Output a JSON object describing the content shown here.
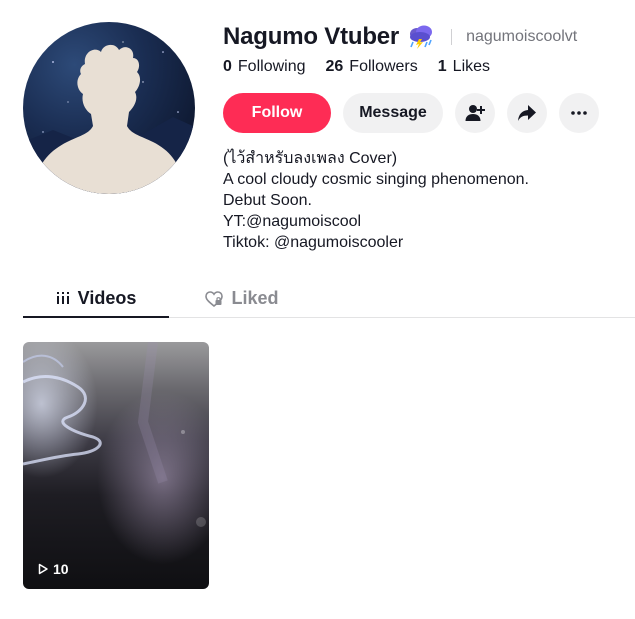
{
  "profile": {
    "display_name": "Nagumo Vtuber",
    "username": "nagumoiscoolvt",
    "name_emoji": "cloud-with-lightning-rain-emoji"
  },
  "stats": [
    {
      "num": "0",
      "label": "Following"
    },
    {
      "num": "26",
      "label": "Followers"
    },
    {
      "num": "1",
      "label": "Likes"
    }
  ],
  "actions": {
    "follow_label": "Follow",
    "message_label": "Message",
    "icons": [
      "add-friend-icon",
      "share-icon",
      "more-icon"
    ]
  },
  "bio": [
    "(ไว้สำหรับลงเพลง Cover)",
    "A cool cloudy cosmic singing phenomenon.",
    "Debut Soon.",
    "YT:@nagumoiscool",
    "Tiktok: @nagumoiscooler"
  ],
  "tabs": {
    "videos": "Videos",
    "liked": "Liked"
  },
  "videos": [
    {
      "play_count": "10"
    }
  ],
  "colors": {
    "follow": "#fe2c55",
    "button_bg": "#f1f1f2",
    "text": "#161823",
    "muted": "#73747b"
  }
}
